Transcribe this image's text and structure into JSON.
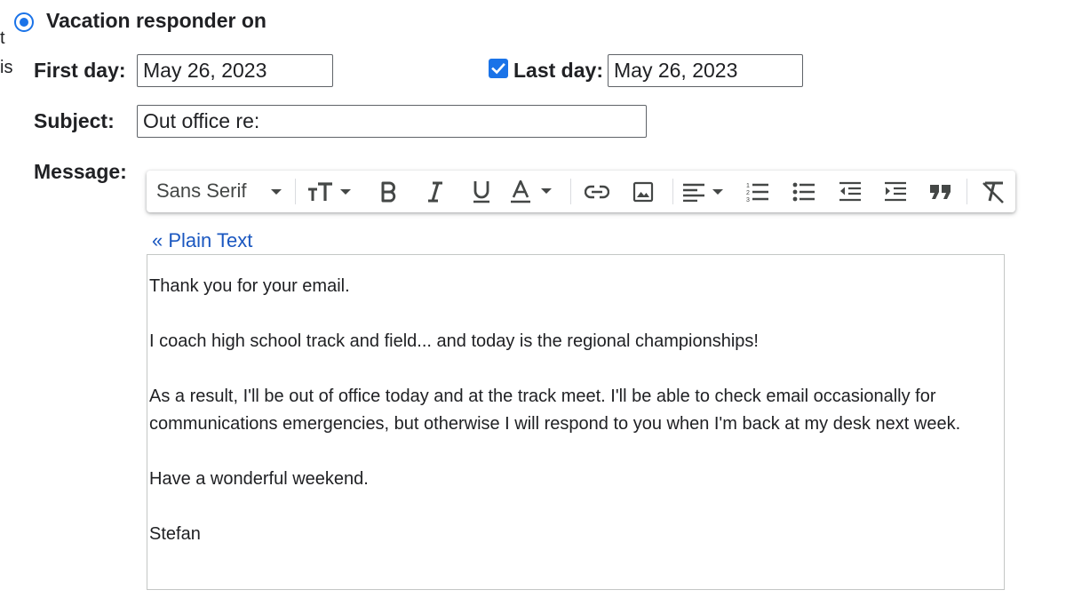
{
  "cut_off_text": [
    "t",
    "is"
  ],
  "vacation": {
    "label": "Vacation responder on",
    "selected": true
  },
  "first_day": {
    "label": "First day:",
    "value": "May 26, 2023"
  },
  "last_day": {
    "label": "Last day:",
    "value": "May 26, 2023",
    "checked": true
  },
  "subject": {
    "label": "Subject:",
    "value": "Out office re:"
  },
  "message": {
    "label": "Message:",
    "plain_text_link": "« Plain Text",
    "paragraphs": [
      "Thank you for your email.",
      "I coach high school track and field... and today is the regional championships!",
      "As a result, I'll be out of office today and at the track meet. I'll be able to check email occasionally for communications emergencies, but otherwise I will respond to you when I'm back at my desk next week.",
      "Have a wonderful weekend.",
      "Stefan"
    ]
  },
  "toolbar": {
    "font_name": "Sans Serif",
    "buttons": [
      "font-size-icon",
      "bold-icon",
      "italic-icon",
      "underline-icon",
      "text-color-icon",
      "link-icon",
      "image-icon",
      "align-icon",
      "numbered-list-icon",
      "bulleted-list-icon",
      "indent-less-icon",
      "indent-more-icon",
      "quote-icon",
      "remove-formatting-icon"
    ]
  },
  "colors": {
    "accent": "#1a73e8",
    "link": "#1a57c0",
    "icon": "#444746",
    "text": "#202124"
  }
}
